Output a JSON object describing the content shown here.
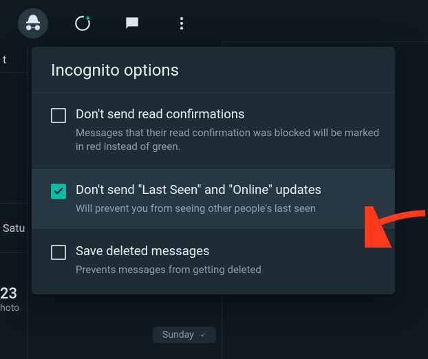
{
  "topbar": {
    "icons": [
      "incognito",
      "status-ring",
      "chat",
      "more-vert"
    ]
  },
  "left": {
    "partial_letter": "t",
    "day_label": "Satu",
    "bottom_date": "23",
    "bottom_sub": "hoto"
  },
  "panel": {
    "title": "Incognito options",
    "options": [
      {
        "checked": false,
        "title": "Don't send read confirmations",
        "desc": "Messages that their read confirmation was blocked will be marked in red instead of green."
      },
      {
        "checked": true,
        "title": "Don't send \"Last Seen\" and \"Online\" updates",
        "desc": "Will prevent you from seeing other people's last seen"
      },
      {
        "checked": false,
        "title": "Save deleted messages",
        "desc": "Prevents messages from getting deleted"
      }
    ]
  },
  "chip": {
    "label": "Sunday"
  },
  "colors": {
    "accent": "#00bfa5",
    "arrow": "#ff3b1f"
  }
}
